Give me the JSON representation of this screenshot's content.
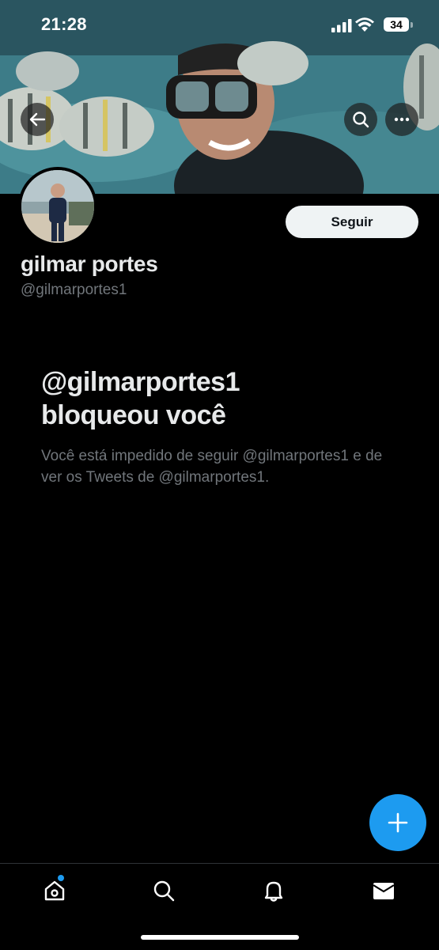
{
  "status_bar": {
    "time": "21:28",
    "battery": "34"
  },
  "header": {
    "back_icon": "arrow-left-icon",
    "search_icon": "search-icon",
    "more_icon": "more-horizontal-icon"
  },
  "profile": {
    "name": "gilmar portes",
    "handle": "@gilmarportes1",
    "follow_label": "Seguir"
  },
  "blocked": {
    "title_line1": "@gilmarportes1",
    "title_line2": "bloqueou você",
    "description": "Você está impedido de seguir @gilmarportes1 e de ver os Tweets de @gilmarportes1."
  },
  "fab": {
    "icon": "plus-icon"
  },
  "tab_bar": {
    "items": [
      {
        "icon": "home-icon",
        "has_badge": true
      },
      {
        "icon": "search-icon"
      },
      {
        "icon": "bell-icon"
      },
      {
        "icon": "mail-icon"
      }
    ]
  },
  "colors": {
    "accent": "#1d9bf0",
    "background": "#000000",
    "primary_text": "#e7e9ea",
    "secondary_text": "#71767b",
    "follow_button_bg": "#eff3f4"
  }
}
